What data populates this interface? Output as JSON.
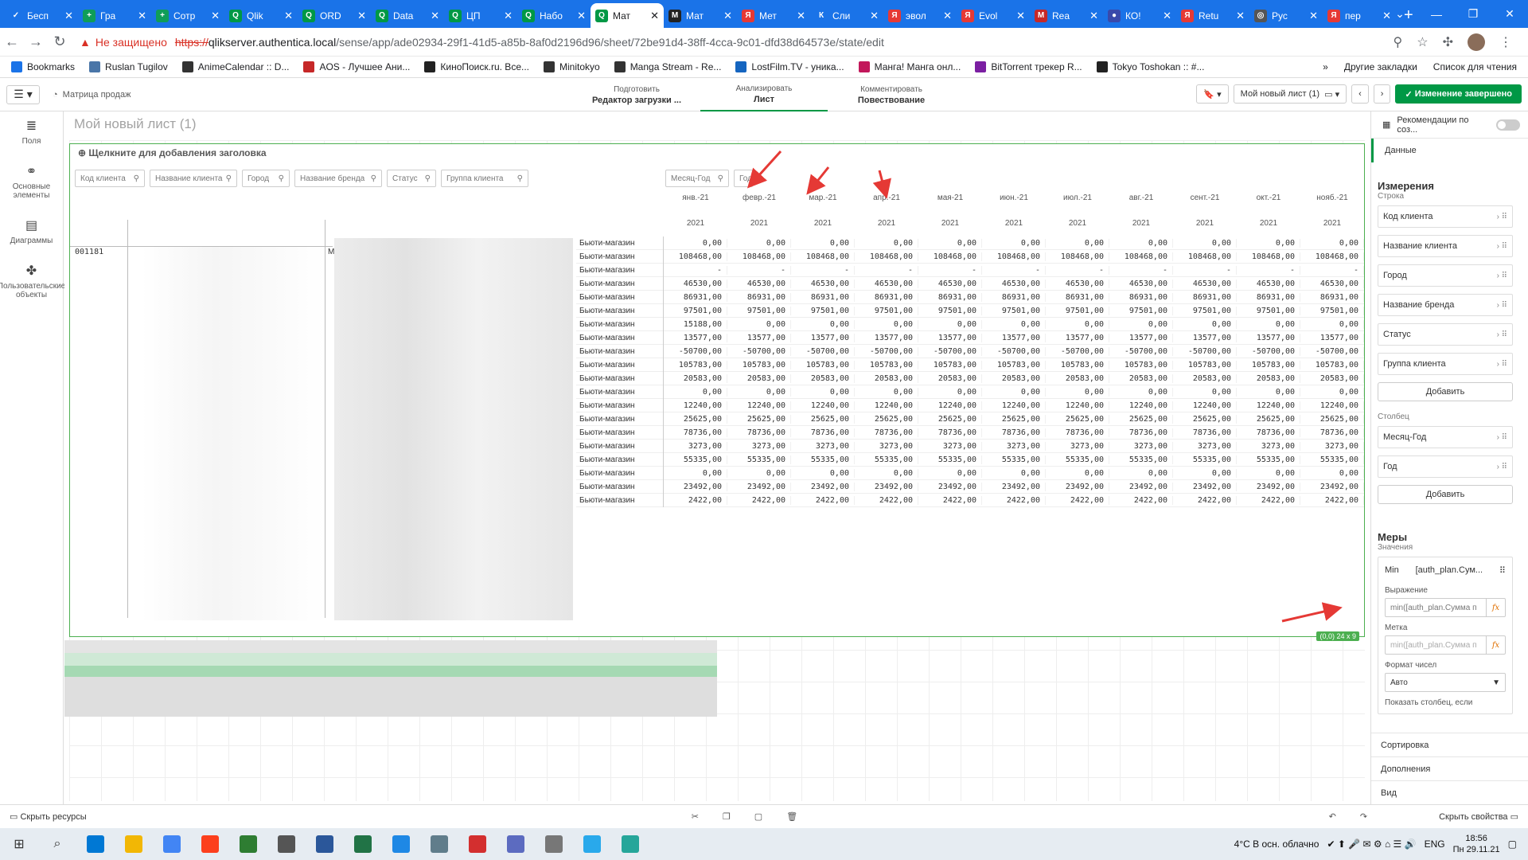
{
  "browser": {
    "tabs": [
      {
        "label": "Бесп",
        "color": "#1a73e8",
        "glyph": "✓"
      },
      {
        "label": "Гра",
        "color": "#0f9d58",
        "glyph": "+"
      },
      {
        "label": "Сотр",
        "color": "#0f9d58",
        "glyph": "+"
      },
      {
        "label": "Qlik",
        "color": "#009845",
        "glyph": "Q"
      },
      {
        "label": "ORD",
        "color": "#009845",
        "glyph": "Q"
      },
      {
        "label": "Data",
        "color": "#009845",
        "glyph": "Q"
      },
      {
        "label": "ЦП",
        "color": "#009845",
        "glyph": "Q"
      },
      {
        "label": "Набо",
        "color": "#009845",
        "glyph": "Q"
      },
      {
        "label": "Мат",
        "color": "#009845",
        "glyph": "Q",
        "active": true
      },
      {
        "label": "Мат",
        "color": "#222",
        "glyph": "M"
      },
      {
        "label": "Мет",
        "color": "#e53935",
        "glyph": "Я"
      },
      {
        "label": "Сли",
        "color": "#1a73e8",
        "glyph": "К"
      },
      {
        "label": "эвол",
        "color": "#e53935",
        "glyph": "Я"
      },
      {
        "label": "Evol",
        "color": "#e53935",
        "glyph": "Я"
      },
      {
        "label": "Rea",
        "color": "#c62828",
        "glyph": "M"
      },
      {
        "label": "КО!",
        "color": "#3949ab",
        "glyph": "●"
      },
      {
        "label": "Retu",
        "color": "#e53935",
        "glyph": "Я"
      },
      {
        "label": "Рус",
        "color": "#555",
        "glyph": "◎"
      },
      {
        "label": "пер",
        "color": "#e53935",
        "glyph": "Я"
      }
    ],
    "insecure_label": "Не защищено",
    "url_proto": "https://",
    "url_host": "qlikserver.authentica.local",
    "url_path": "/sense/app/ade02934-29f1-41d5-a85b-8af0d2196d96/sheet/72be91d4-38ff-4cca-9c01-dfd38d64573e/state/edit",
    "bookmarks": [
      {
        "label": "Bookmarks",
        "color": "#1a73e8"
      },
      {
        "label": "Ruslan Tugilov",
        "color": "#4a76a8"
      },
      {
        "label": "AnimeCalendar :: D...",
        "color": "#333"
      },
      {
        "label": "AOS - Лучшее Ани...",
        "color": "#c62828"
      },
      {
        "label": "КиноПоиск.ru. Все...",
        "color": "#222"
      },
      {
        "label": "Minitokyo",
        "color": "#333"
      },
      {
        "label": "Manga Stream - Re...",
        "color": "#333"
      },
      {
        "label": "LostFilm.TV - уника...",
        "color": "#1565c0"
      },
      {
        "label": "Манга! Манга онл...",
        "color": "#c2185b"
      },
      {
        "label": "BitTorrent трекер R...",
        "color": "#7b1fa2"
      },
      {
        "label": "Tokyo Toshokan :: #...",
        "color": "#222"
      }
    ],
    "other_bookmarks": "Другие закладки",
    "reading_list": "Список для чтения"
  },
  "qlik": {
    "app_name": "Матрица продаж",
    "modes": [
      {
        "small": "Подготовить",
        "value": "Редактор загрузки ...",
        "active": false
      },
      {
        "small": "Анализировать",
        "value": "Лист",
        "active": true
      },
      {
        "small": "Комментировать",
        "value": "Повествование",
        "active": false
      }
    ],
    "sheet_name": "Мой новый лист (1)",
    "done_label": "Изменение завершено",
    "sheet_title": "Мой новый лист (1)",
    "object_title": "Щелкните для добавления заголовка",
    "left_panel": [
      "Поля",
      "Основные элементы",
      "Диаграммы",
      "Пользовательские объекты"
    ],
    "row_filters": [
      "Код клиента",
      "Название клиента",
      "Город",
      "Название бренда",
      "Статус",
      "Группа клиента"
    ],
    "col_filters": [
      "Месяц-Год",
      "Год"
    ],
    "months": [
      "янв.-21",
      "февр.-21",
      "мар.-21",
      "апр.-21",
      "мая-21",
      "июн.-21",
      "июл.-21",
      "авг.-21",
      "сент.-21",
      "окт.-21",
      "нояб.-21"
    ],
    "year": "2021",
    "client_code": "001181",
    "brand_initial": "М",
    "row_label": "Бьюти-магазин",
    "row_values": [
      "0,00",
      "108468,00",
      "-",
      "46530,00",
      "86931,00",
      "97501,00",
      "15188,00",
      "13577,00",
      "-50700,00",
      "105783,00",
      "20583,00",
      "0,00",
      "12240,00",
      "25625,00",
      "78736,00",
      "3273,00",
      "55335,00",
      "0,00",
      "23492,00",
      "2422,00"
    ],
    "row_values_rest": [
      "0,00",
      "108468,00",
      "-",
      "46530,00",
      "86931,00",
      "97501,00",
      "0,00",
      "13577,00",
      "-50700,00",
      "105783,00",
      "20583,00",
      "0,00",
      "12240,00",
      "25625,00",
      "78736,00",
      "3273,00",
      "55335,00",
      "0,00",
      "23492,00",
      "2422,00"
    ],
    "sel_badge": "(0,0) 24 x 9",
    "right_panel": {
      "reco": "Рекомендации по соз...",
      "tab": "Данные",
      "dimensions": "Измерения",
      "rows_label": "Строка",
      "row_fields": [
        "Код клиента",
        "Название клиента",
        "Город",
        "Название бренда",
        "Статус",
        "Группа клиента"
      ],
      "add": "Добавить",
      "column_label": "Столбец",
      "col_fields": [
        "Месяц-Год",
        "Год"
      ],
      "measures": "Меры",
      "values_label": "Значения",
      "measure_agg": "Min",
      "measure_name": "[auth_plan.Сум...",
      "expr_label": "Выражение",
      "expr_value": "min([auth_plan.Сумма п",
      "label_label": "Метка",
      "label_value": "min([auth_plan.Сумма п",
      "numfmt_label": "Формат чисел",
      "numfmt_value": "Авто",
      "show_col_label": "Показать столбец, если",
      "bottom": [
        "Сортировка",
        "Дополнения",
        "Вид"
      ]
    },
    "bottom_left": "Скрыть ресурсы",
    "bottom_right": "Скрыть свойства"
  },
  "taskbar": {
    "weather": "4°C  В осн. облачно",
    "lang": "ENG",
    "time": "18:56",
    "date": "Пн 29.11.21",
    "apps": [
      "#0078d4",
      "#f2b705",
      "#4285f4",
      "#fc3f1d",
      "#2e7d32",
      "#555",
      "#2b579a",
      "#217346",
      "#1e88e5",
      "#607d8b",
      "#d32f2f",
      "#5c6bc0",
      "#777",
      "#29a9eb",
      "#26a69a"
    ]
  }
}
